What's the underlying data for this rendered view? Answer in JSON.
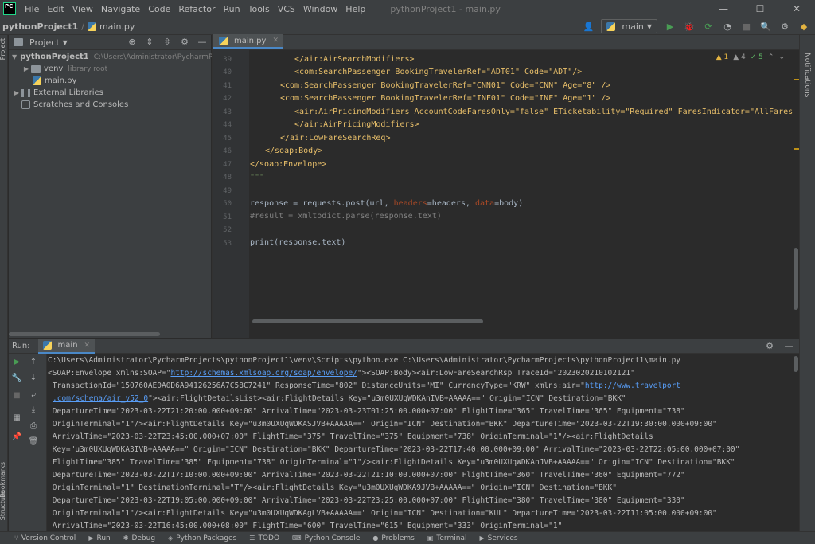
{
  "menubar": {
    "logo": "PC",
    "items": [
      "File",
      "Edit",
      "View",
      "Navigate",
      "Code",
      "Refactor",
      "Run",
      "Tools",
      "VCS",
      "Window",
      "Help"
    ],
    "window_title": "pythonProject1 - main.py",
    "minimize": "—",
    "maximize": "☐",
    "close": "✕"
  },
  "navbar": {
    "project": "pythonProject1",
    "file": "main.py",
    "run_config": "main"
  },
  "stripes": {
    "left_top": "Project",
    "left_bookmarks": "Bookmarks",
    "left_structure": "Structure",
    "right_notifications": "Notifications"
  },
  "project_panel": {
    "title": "Project",
    "tree": [
      {
        "label": "pythonProject1",
        "path": "C:\\Users\\Administrator\\PycharmProje",
        "type": "folder",
        "expanded": true
      },
      {
        "label": "venv",
        "hint": "library root",
        "type": "folder",
        "expanded": false
      },
      {
        "label": "main.py",
        "type": "py"
      },
      {
        "label": "External Libraries",
        "type": "lib"
      },
      {
        "label": "Scratches and Consoles",
        "type": "scratch"
      }
    ]
  },
  "editor": {
    "tab": "main.py",
    "inspections": {
      "warn1": "1",
      "warn2": "4",
      "ok": "5"
    },
    "line_numbers": [
      "39",
      "40",
      "41",
      "42",
      "43",
      "44",
      "45",
      "46",
      "47",
      "48",
      "49",
      "50",
      "51",
      "52",
      "53"
    ],
    "lines": {
      "l39": "</air:AirSearchModifiers>",
      "l40": "<com:SearchPassenger BookingTravelerRef=\"ADT01\" Code=\"ADT\"/>",
      "l41": "<com:SearchPassenger BookingTravelerRef=\"CNN01\" Code=\"CNN\" Age=\"8\" />",
      "l42": "<com:SearchPassenger BookingTravelerRef=\"INF01\" Code=\"INF\" Age=\"1\" />",
      "l43": "<air:AirPricingModifiers AccountCodeFaresOnly=\"false\" ETicketability=\"Required\" FaresIndicator=\"AllFares\">",
      "l44": "</air:AirPricingModifiers>",
      "l45": "</air:LowFareSearchReq>",
      "l46": "</soap:Body>",
      "l47": "</soap:Envelope>",
      "l48": "\"\"\"",
      "l51_a": "response = requests.post(url, ",
      "l51_b": "headers",
      "l51_c": "=headers, ",
      "l51_d": "data",
      "l51_e": "=body)",
      "l52": "#result = xmltodict.parse(response.text)",
      "l54": "print(response.text)"
    }
  },
  "run_panel": {
    "label": "Run:",
    "tab": "main",
    "console": [
      "C:\\Users\\Administrator\\PycharmProjects\\pythonProject1\\venv\\Scripts\\python.exe C:\\Users\\Administrator\\PycharmProjects\\pythonProject1\\main.py",
      " TransactionId=\"150760AE0A0D6A94126256A7C58C7241\" ResponseTime=\"802\" DistanceUnits=\"MI\" CurrencyType=\"KRW\" xmlns:air=\"",
      " DepartureTime=\"2023-03-22T21:20:00.000+09:00\" ArrivalTime=\"2023-03-23T01:25:00.000+07:00\" FlightTime=\"365\" TravelTime=\"365\" Equipment=\"738\"",
      " OriginTerminal=\"1\"/><air:FlightDetails Key=\"u3m0UXUqWDKASJVB+AAAAA==\" Origin=\"ICN\" Destination=\"BKK\" DepartureTime=\"2023-03-22T19:30:00.000+09:00\"",
      " ArrivalTime=\"2023-03-22T23:45:00.000+07:00\" FlightTime=\"375\" TravelTime=\"375\" Equipment=\"738\" OriginTerminal=\"1\"/><air:FlightDetails",
      " Key=\"u3m0UXUqWDKA3IVB+AAAAA==\" Origin=\"ICN\" Destination=\"BKK\" DepartureTime=\"2023-03-22T17:40:00.000+09:00\" ArrivalTime=\"2023-03-22T22:05:00.000+07:00\"",
      " FlightTime=\"385\" TravelTime=\"385\" Equipment=\"738\" OriginTerminal=\"1\"/><air:FlightDetails Key=\"u3m0UXUqWDKAnJVB+AAAAA==\" Origin=\"ICN\" Destination=\"BKK\"",
      " DepartureTime=\"2023-03-22T17:10:00.000+09:00\" ArrivalTime=\"2023-03-22T21:10:00.000+07:00\" FlightTime=\"360\" TravelTime=\"360\" Equipment=\"772\"",
      " OriginTerminal=\"1\" DestinationTerminal=\"T\"/><air:FlightDetails Key=\"u3m0UXUqWDKA9JVB+AAAAA==\" Origin=\"ICN\" Destination=\"BKK\"",
      " DepartureTime=\"2023-03-22T19:05:00.000+09:00\" ArrivalTime=\"2023-03-22T23:25:00.000+07:00\" FlightTime=\"380\" TravelTime=\"380\" Equipment=\"330\"",
      " OriginTerminal=\"1\"/><air:FlightDetails Key=\"u3m0UXUqWDKAgLVB+AAAAA==\" Origin=\"ICN\" Destination=\"KUL\" DepartureTime=\"2023-03-22T11:05:00.000+09:00\"",
      " ArrivalTime=\"2023-03-22T16:45:00.000+08:00\" FlightTime=\"600\" TravelTime=\"615\" Equipment=\"333\" OriginTerminal=\"1\""
    ],
    "envelope_a": "<SOAP:Envelope xmlns:SOAP=\"",
    "envelope_link": "http://schemas.xmlsoap.org/soap/envelope/",
    "envelope_b": "\"><SOAP:Body><air:LowFareSearchRsp TraceId=\"2023020210102121\"",
    "travelport_link": "http://www.travelport",
    "schema_link": ".com/schema/air_v52_0",
    "schema_rest": "\"><air:FlightDetailsList><air:FlightDetails Key=\"u3m0UXUqWDKAnIVB+AAAAA==\" Origin=\"ICN\" Destination=\"BKK\""
  },
  "bottom_bar": {
    "items": [
      "Version Control",
      "Run",
      "Debug",
      "Python Packages",
      "TODO",
      "Python Console",
      "Problems",
      "Terminal",
      "Services"
    ]
  }
}
